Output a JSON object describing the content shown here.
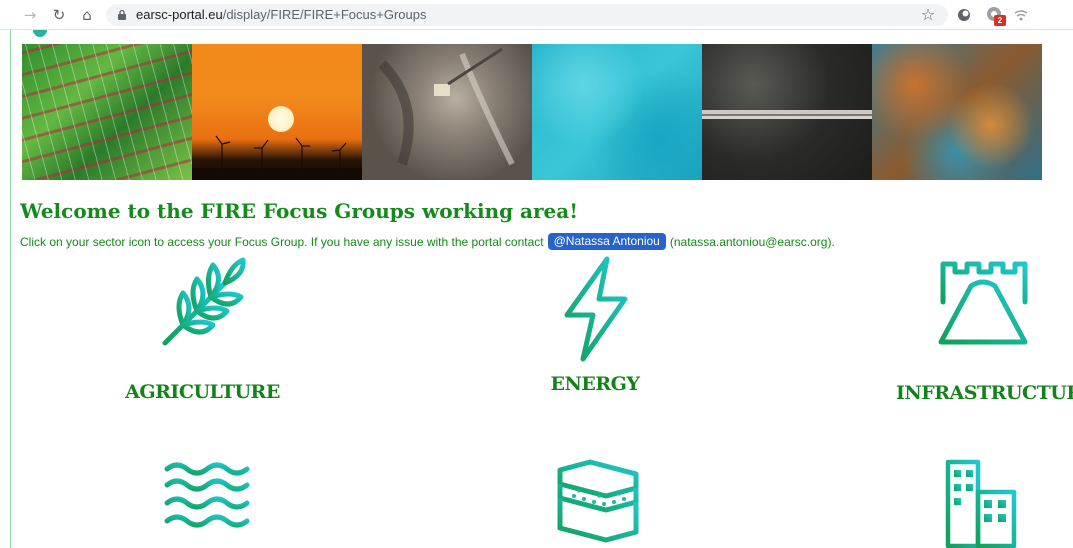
{
  "browser": {
    "url_domain": "earsc-portal.eu",
    "url_path": "/display/FIRE/FIRE+Focus+Groups",
    "extension_badge": "2",
    "icons": [
      "back-arrow-icon",
      "reload-icon",
      "home-icon",
      "lock-icon",
      "star-icon",
      "extension-icon"
    ]
  },
  "banner": {
    "tiles": [
      "agriculture-fields",
      "sunset-wind-turbines",
      "open-pit-mine",
      "turquoise-sea",
      "city-aerial",
      "rust-terrain"
    ]
  },
  "page": {
    "title": "Welcome to the FIRE Focus Groups working area!",
    "intro_before": "Click on your sector icon to access your Focus Group. If you have any issue with the portal contact",
    "mention": "@Natassa Antoniou",
    "intro_after": "(natassa.antoniou@earsc.org)."
  },
  "sectors": [
    {
      "label": "AGRICULTURE",
      "icon": "wheat-icon"
    },
    {
      "label": "ENERGY",
      "icon": "lightning-icon"
    },
    {
      "label": "INFRASTRUCTURE",
      "icon": "road-bridge-icon"
    },
    {
      "label": "",
      "icon": "waves-icon"
    },
    {
      "label": "",
      "icon": "soil-layers-icon"
    },
    {
      "label": "",
      "icon": "buildings-icon"
    }
  ],
  "colors": {
    "title_green": "#138a1a",
    "icon_gradient_start": "#14a05a",
    "icon_gradient_end": "#1fc7cf",
    "mention_blue": "#2764c9"
  }
}
